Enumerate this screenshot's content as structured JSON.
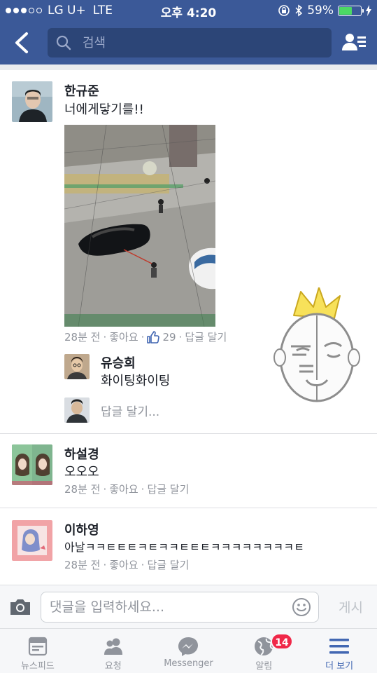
{
  "status_bar": {
    "carrier": "LG U+",
    "network": "LTE",
    "time": "오후 4:20",
    "battery": "59%",
    "battery_level": 0.59
  },
  "nav": {
    "search_placeholder": "검색"
  },
  "comments": [
    {
      "author": "한규준",
      "text": "너에게닿기를!!",
      "time": "28분 전",
      "like_label": "좋아요",
      "like_count": "29",
      "reply_label": "답글 달기",
      "replies": [
        {
          "author": "유승희",
          "text": "화이팅화이팅"
        }
      ],
      "reply_input_placeholder": "답글 달기..."
    },
    {
      "author": "하설경",
      "text": "오오오",
      "time": "28분 전",
      "like_label": "좋아요",
      "reply_label": "답글 달기"
    },
    {
      "author": "이하영",
      "text": "아날ㅋㅋㅌㅌㅌㅋㅌㅋㅋㅌㅌㅌㅋㅋㅋㅋㅋㅋㅋㅋㅌ",
      "time": "28분 전",
      "like_label": "좋아요",
      "reply_label": "답글 달기"
    }
  ],
  "composer": {
    "placeholder": "댓글을 입력하세요...",
    "post_label": "게시"
  },
  "tabs": [
    {
      "label": "뉴스피드",
      "icon": "newsfeed-icon"
    },
    {
      "label": "요청",
      "icon": "friend-requests-icon"
    },
    {
      "label": "Messenger",
      "icon": "messenger-icon"
    },
    {
      "label": "알림",
      "icon": "globe-icon",
      "badge": "14"
    },
    {
      "label": "더 보기",
      "icon": "menu-icon",
      "active": true
    }
  ],
  "colors": {
    "brand": "#3b5998",
    "accent": "#4267b2",
    "badge": "#f02849"
  }
}
